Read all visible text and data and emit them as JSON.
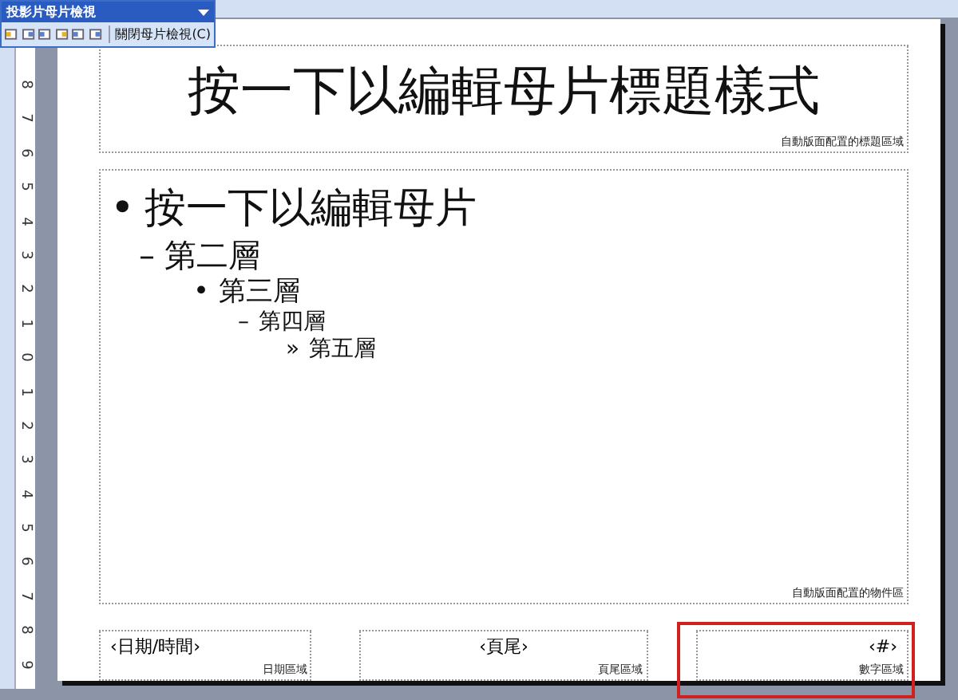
{
  "toolbar": {
    "title": "投影片母片檢視",
    "close_button": "關閉母片檢視(C)"
  },
  "ruler": {
    "numbers": [
      "8",
      "7",
      "6",
      "5",
      "4",
      "3",
      "2",
      "1",
      "0",
      "1",
      "2",
      "3",
      "4",
      "5",
      "6",
      "7",
      "8",
      "9"
    ]
  },
  "slide": {
    "title": {
      "text": "按一下以編輯母片標題樣式",
      "area_label": "自動版面配置的標題區域"
    },
    "body": {
      "area_label": "自動版面配置的物件區",
      "outline": [
        {
          "marker": "•",
          "text": "按一下以編輯母片",
          "children": [
            {
              "marker": "–",
              "text": "第二層",
              "children": [
                {
                  "marker": "•",
                  "text": "第三層",
                  "children": [
                    {
                      "marker": "–",
                      "text": "第四層",
                      "children": [
                        {
                          "marker": "»",
                          "text": "第五層"
                        }
                      ]
                    }
                  ]
                }
              ]
            }
          ]
        }
      ]
    },
    "footer": [
      {
        "kind": "date",
        "text": "‹日期/時間›",
        "area_label": "日期區域",
        "highlighted": false
      },
      {
        "kind": "footer",
        "text": "‹頁尾›",
        "area_label": "頁尾區域",
        "highlighted": false
      },
      {
        "kind": "number",
        "text": "‹#›",
        "area_label": "數字區域",
        "highlighted": true
      }
    ]
  }
}
